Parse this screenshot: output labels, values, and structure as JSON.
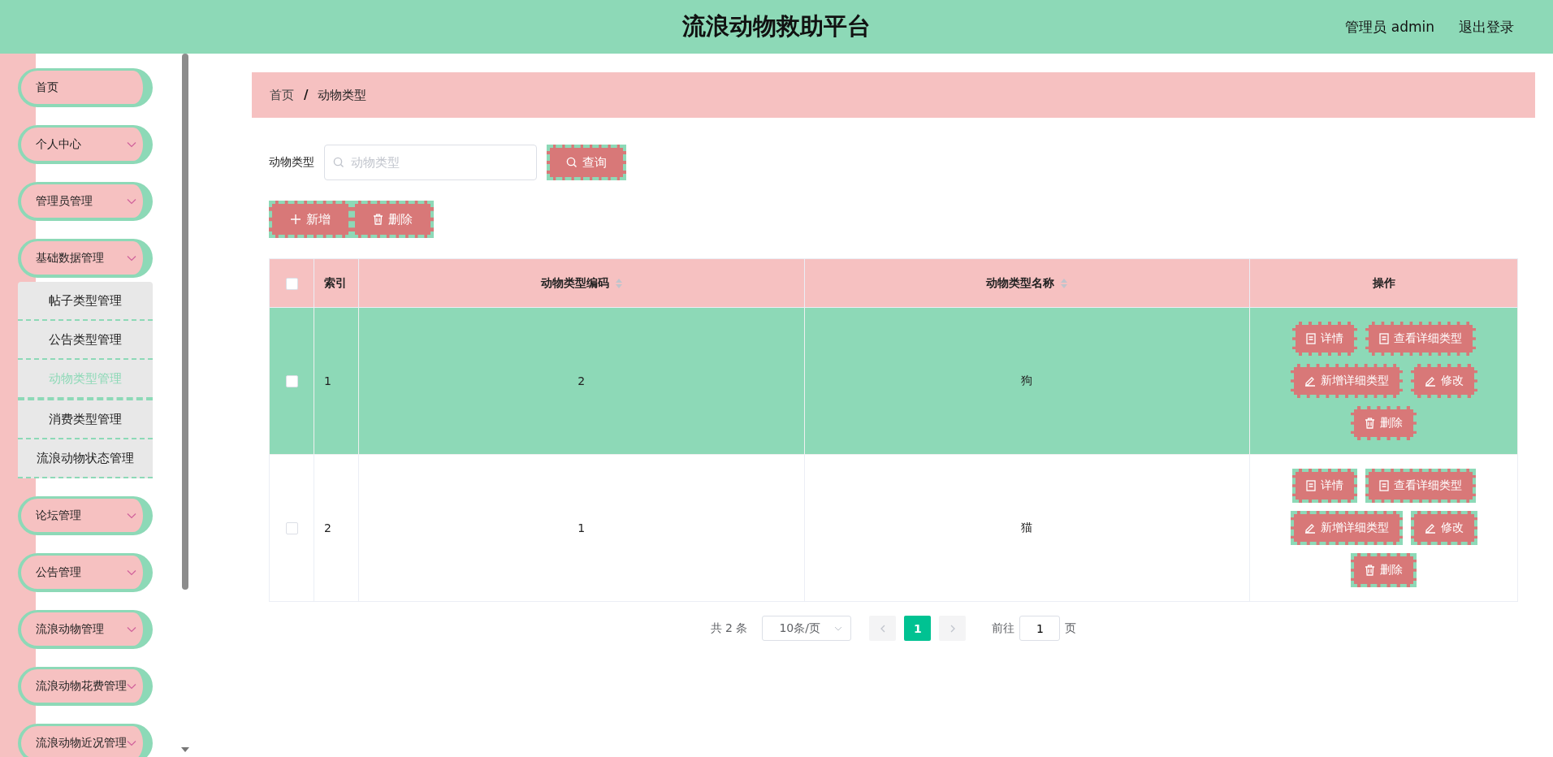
{
  "header": {
    "title": "流浪动物救助平台",
    "user": "管理员 admin",
    "logout": "退出登录"
  },
  "sidebar": {
    "items": [
      {
        "label": "首页",
        "kind": "link"
      },
      {
        "label": "个人中心",
        "kind": "group"
      },
      {
        "label": "管理员管理",
        "kind": "group"
      },
      {
        "label": "基础数据管理",
        "kind": "group",
        "children": [
          {
            "label": "帖子类型管理",
            "selected": false
          },
          {
            "label": "公告类型管理",
            "selected": false
          },
          {
            "label": "动物类型管理",
            "selected": true
          },
          {
            "label": "消费类型管理",
            "selected": false
          },
          {
            "label": "流浪动物状态管理",
            "selected": false
          }
        ]
      },
      {
        "label": "论坛管理",
        "kind": "group"
      },
      {
        "label": "公告管理",
        "kind": "group"
      },
      {
        "label": "流浪动物管理",
        "kind": "group"
      },
      {
        "label": "流浪动物花费管理",
        "kind": "group"
      },
      {
        "label": "流浪动物近况管理",
        "kind": "group"
      }
    ]
  },
  "breadcrumb": [
    "首页",
    "动物类型"
  ],
  "breadcrumb_separator": "/",
  "search": {
    "label": "动物类型",
    "placeholder": "动物类型",
    "button": "查询"
  },
  "actions": [
    {
      "label": "新增",
      "kind": "add"
    },
    {
      "label": "删除",
      "kind": "delete"
    }
  ],
  "table": {
    "all_checked": false,
    "columns": [
      {
        "label": "索引",
        "sortable": false
      },
      {
        "label": "动物类型编码",
        "sortable": true
      },
      {
        "label": "动物类型名称",
        "sortable": true
      },
      {
        "label": "操作",
        "sortable": false
      }
    ],
    "rows": [
      {
        "index": "1",
        "code": "2",
        "name": "狗",
        "selected": true,
        "checked": false,
        "actions": [
          {
            "label": "详情",
            "kind": "doc"
          },
          {
            "label": "查看详细类型",
            "kind": "doc"
          },
          {
            "label": "新增详细类型",
            "kind": "edit"
          },
          {
            "label": "修改",
            "kind": "edit"
          },
          {
            "label": "删除",
            "kind": "delete"
          }
        ]
      },
      {
        "index": "2",
        "code": "1",
        "name": "猫",
        "selected": false,
        "checked": false,
        "actions": [
          {
            "label": "详情",
            "kind": "doc"
          },
          {
            "label": "查看详细类型",
            "kind": "doc"
          },
          {
            "label": "新增详细类型",
            "kind": "edit"
          },
          {
            "label": "修改",
            "kind": "edit"
          },
          {
            "label": "删除",
            "kind": "delete"
          }
        ]
      }
    ]
  },
  "pagination": {
    "total": "共 2 条",
    "page_size": "10条/页",
    "pages": [
      {
        "label": "1",
        "selected": true
      }
    ],
    "goto_label": "前往",
    "goto_value": "1",
    "goto_suffix": "页"
  }
}
